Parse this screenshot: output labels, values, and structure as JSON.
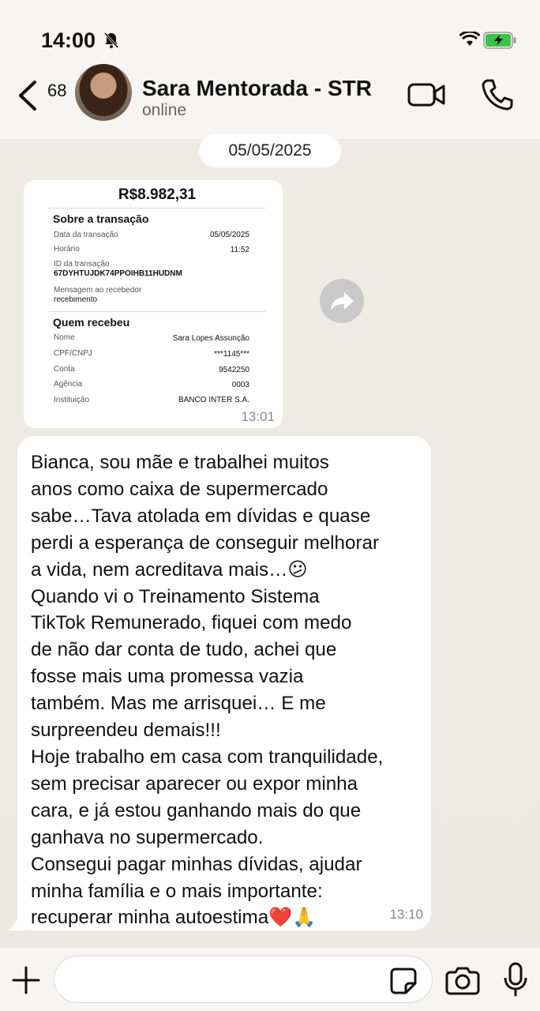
{
  "status_bar": {
    "time": "14:00"
  },
  "header": {
    "unread_count": "68",
    "contact_name": "Sara Mentorada - STR",
    "contact_status": "online"
  },
  "chat": {
    "date": "05/05/2025",
    "receipt_message": {
      "amount": "R$8.982,31",
      "section_transaction": "Sobre a transação",
      "date_label": "Data da transação",
      "date_value": "05/05/2025",
      "time_label": "Horário",
      "time_value": "11:52",
      "id_label": "ID da transação",
      "id_value": "67DYHTUJDK74PPOIHB11HUDNM",
      "note_label": "Mensagem ao recebedor",
      "note_value": "recebimento",
      "section_receiver": "Quem recebeu",
      "name_label": "Nome",
      "name_value": "Sara Lopes Assunção",
      "cpf_label": "CPF/CNPJ",
      "cpf_value": "***1145***",
      "account_label": "Conta",
      "account_value": "9542250",
      "agency_label": "Agência",
      "agency_value": "0003",
      "institution_label": "Instituição",
      "institution_value": "BANCO INTER S.A.",
      "timestamp": "13:01"
    },
    "text_message": {
      "body": "Bianca, sou mãe e trabalhei muitos\nanos como caixa de supermercado\nsabe…Tava atolada em dívidas e quase\nperdi a esperança de conseguir melhorar\na vida, nem acreditava mais…😕\nQuando vi o Treinamento Sistema\nTikTok Remunerado, fiquei com medo\nde não dar conta de tudo, achei que\nfosse mais uma promessa vazia\ntambém. Mas me arrisquei… E me\nsurpreendeu demais!!!\nHoje trabalho em casa com tranquilidade,\nsem precisar aparecer ou expor minha\ncara, e já estou ganhando mais do que\nganhava no supermercado.\nConsegui pagar minhas dívidas, ajudar\nminha família e o mais importante:\nrecuperar minha autoestima❤️🙏",
      "timestamp": "13:10"
    }
  },
  "composer": {
    "placeholder": ""
  },
  "icons": {
    "bell": "bell-slash-icon",
    "wifi": "wifi-icon",
    "battery": "battery-charging-icon",
    "back": "chevron-left-icon",
    "video": "video-call-icon",
    "phone": "phone-icon",
    "forward": "forward-icon",
    "plus": "plus-icon",
    "sticker": "sticker-icon",
    "camera": "camera-icon",
    "mic": "microphone-icon"
  },
  "colors": {
    "background": "#ece9e3",
    "bubble": "#ffffff",
    "battery_green": "#3dc24a"
  }
}
